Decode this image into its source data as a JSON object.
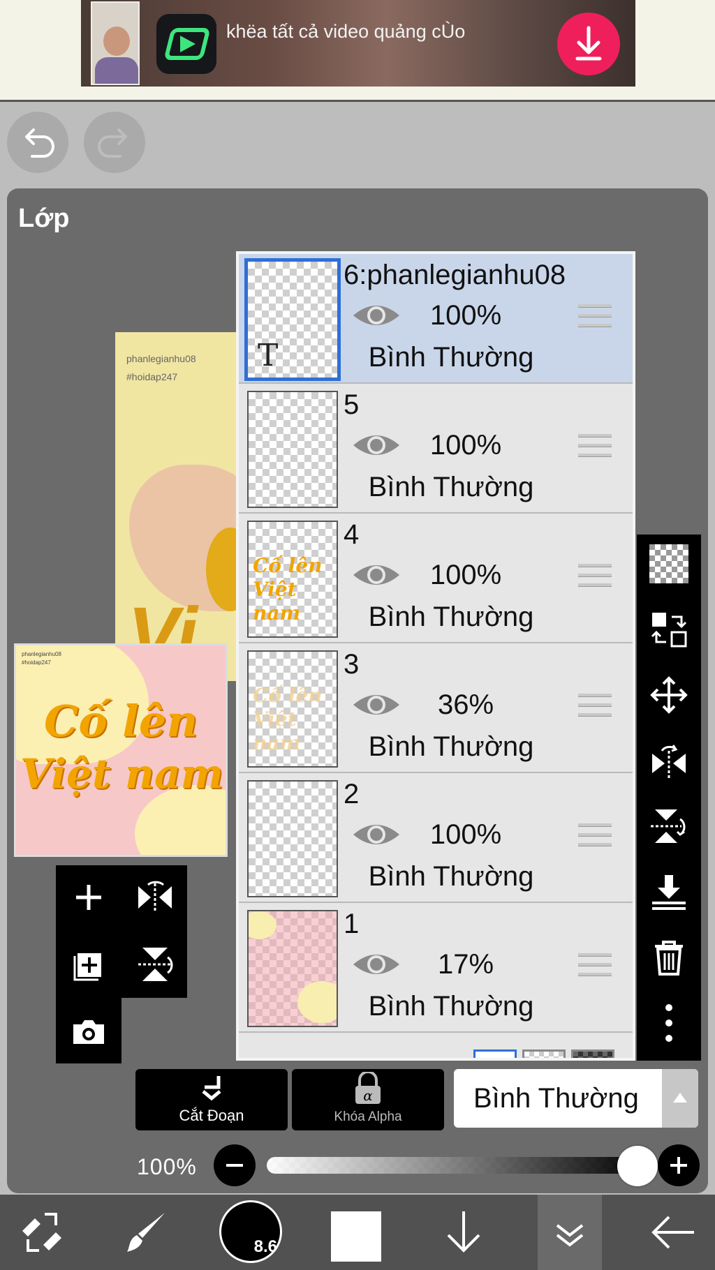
{
  "ad": {
    "text": "khëa tất cả video quảng cÙo",
    "accent": "#ef1f5c"
  },
  "toolbar_top": {
    "undo_icon": "undo-icon",
    "redo_icon": "redo-icon"
  },
  "panel": {
    "title": "Lớp"
  },
  "canvas_preview": {
    "line1": "phanlegianhu08",
    "line2": "#hoidap247",
    "big_letter": "Vi"
  },
  "thumb_preview": {
    "tiny1": "phanlegianhu08",
    "tiny2": "#hoidap247",
    "title1": "Cố lên",
    "title2": "Việt nam"
  },
  "layers": [
    {
      "name": "6:phanlegianhu08",
      "opacity": "100%",
      "blend": "Bình Thường",
      "selected": true
    },
    {
      "name": "5",
      "opacity": "100%",
      "blend": "Bình Thường",
      "selected": false
    },
    {
      "name": "4",
      "opacity": "100%",
      "blend": "Bình Thường",
      "selected": false,
      "thumb_text": [
        "Cố lên",
        "Việt nam"
      ]
    },
    {
      "name": "3",
      "opacity": "36%",
      "blend": "Bình Thường",
      "selected": false,
      "thumb_text": [
        "Cố lên",
        "Việt nam"
      ]
    },
    {
      "name": "2",
      "opacity": "100%",
      "blend": "Bình Thường",
      "selected": false
    },
    {
      "name": "1",
      "opacity": "17%",
      "blend": "Bình Thường",
      "selected": false
    }
  ],
  "layer6_thumb_glyph": "T",
  "controls": {
    "clip_label": "Cắt Đoạn",
    "alpha_lock_label": "Khóa Alpha",
    "blend_mode": "Bình Thường",
    "opacity_label": "100%",
    "opacity_value": 1.0
  },
  "bottom_toolbar": {
    "brush_size": "8.6",
    "color": "#ffffff"
  },
  "colors": {
    "selected_row": "#c9d6ea",
    "selection_border": "#2f6fd6",
    "panel_bg": "#6b6b6b"
  }
}
